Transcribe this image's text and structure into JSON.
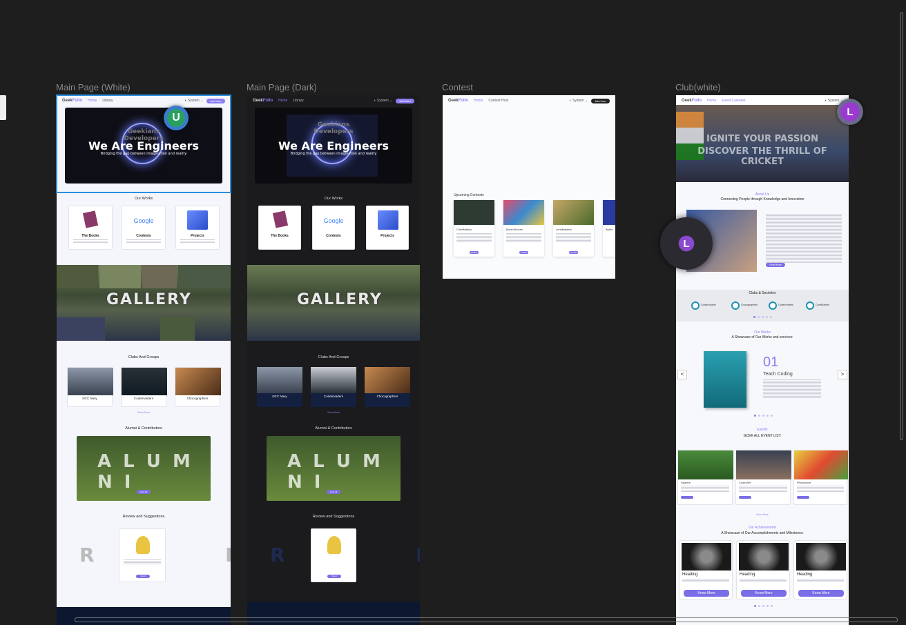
{
  "canvas": {
    "background": "#1e1e1e"
  },
  "frames": {
    "white": {
      "label": "Main Page (White)"
    },
    "dark": {
      "label": "Main Page (Dark)"
    },
    "contest": {
      "label": "Contest"
    },
    "club": {
      "label": "Club(white)"
    }
  },
  "nav": {
    "logo_a": "Geek",
    "logo_b": "Folio",
    "home": "Home",
    "library": "Library",
    "system": "System",
    "cta": "Add User",
    "contest_links": [
      "Home",
      "Contest Host"
    ],
    "club_links": [
      "Home",
      "Event Calendar"
    ]
  },
  "hero": {
    "title": "We Are Engineers",
    "subtitle": "Bridging the gap between imagination and reality",
    "overlay": "Geekians\nDevelopers"
  },
  "works": {
    "title": "Our Works",
    "items": [
      "The Books",
      "Contests",
      "Projects"
    ],
    "google": "Google"
  },
  "gallery": {
    "word": "GALLERY"
  },
  "clubs": {
    "title": "Clubs And Groups",
    "items": [
      "NCC Navy",
      "CodeInvaders",
      "Chocographers"
    ],
    "more": "Show More"
  },
  "alumni": {
    "title": "Alumni  & Contributors",
    "word1": "A L U M N I",
    "button": "View All"
  },
  "review": {
    "title": "Review and Suggestions",
    "word": "R E     E W",
    "button": "Send"
  },
  "contest_page": {
    "section": "Upcoming Contests",
    "cards": [
      "CodeManiac",
      "BrushStrokes",
      "LensMasters",
      "Bythe"
    ],
    "button": "Details"
  },
  "club_page": {
    "hero_line1": "IGNITE YOUR PASSION",
    "hero_line2": "DISCOVER THE THRILL OF CRICKET",
    "about_kicker": "About Us",
    "about_title": "Connecting People through Knowledge and Innovation",
    "read_more": "Read More",
    "clubs_title": "Clubs & Societies",
    "club_names": [
      "CodeInvaders",
      "Chocographers",
      "CodeInvaders",
      "CodeMakers"
    ],
    "works_kicker": "Our Works",
    "works_title": "A Showcase of Our Works and services:",
    "work_number": "01",
    "work_name": "Teach Coding",
    "events_kicker": "Events",
    "events_title": "GCEK ALL EVENT LIST:",
    "events": [
      "Sparten",
      "Codechef",
      "Photoshoot"
    ],
    "show_more": "Show More",
    "ach_kicker": "Our Achievements",
    "ach_title": "A Showcase of Our Accomplishments and Milestones:",
    "ach_heading": "Heading",
    "ach_button": "Know More",
    "prev": "<",
    "next": ">"
  },
  "avatars": {
    "u": "U",
    "l1": "L",
    "l2": "L"
  }
}
